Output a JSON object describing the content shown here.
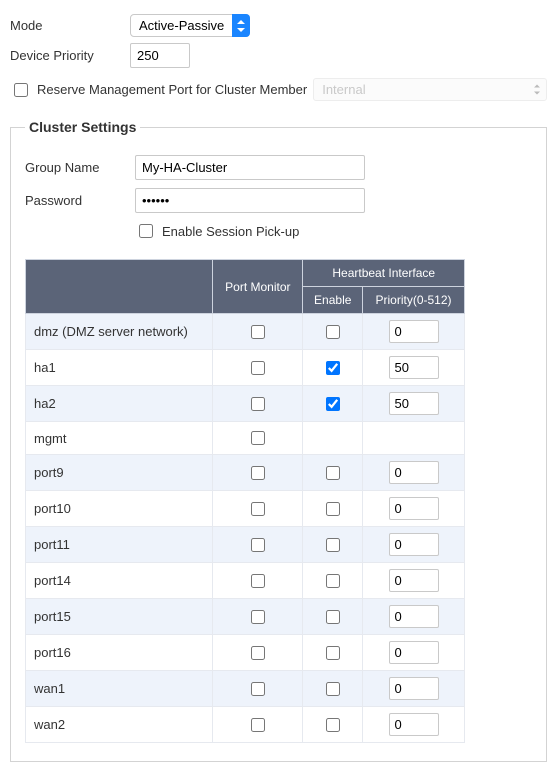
{
  "top": {
    "mode_label": "Mode",
    "mode_value": "Active-Passive",
    "device_priority_label": "Device Priority",
    "device_priority_value": "250",
    "reserve_checked": false,
    "reserve_label": "Reserve Management Port for Cluster Member",
    "reserve_port_value": "Internal"
  },
  "cluster": {
    "legend": "Cluster Settings",
    "group_name_label": "Group Name",
    "group_name_value": "My-HA-Cluster",
    "password_label": "Password",
    "password_value": "••••••",
    "session_pickup_checked": false,
    "session_pickup_label": "Enable Session Pick-up",
    "headers": {
      "port_monitor": "Port Monitor",
      "heartbeat": "Heartbeat Interface",
      "enable": "Enable",
      "priority": "Priority(0-512)"
    },
    "rows": [
      {
        "name": "dmz (DMZ server network)",
        "port_monitor": false,
        "hb_enable": false,
        "hb_priority": "0",
        "has_priority": true
      },
      {
        "name": "ha1",
        "port_monitor": false,
        "hb_enable": true,
        "hb_priority": "50",
        "has_priority": true
      },
      {
        "name": "ha2",
        "port_monitor": false,
        "hb_enable": true,
        "hb_priority": "50",
        "has_priority": true
      },
      {
        "name": "mgmt",
        "port_monitor": false,
        "hb_enable": null,
        "hb_priority": null,
        "has_priority": false
      },
      {
        "name": "port9",
        "port_monitor": false,
        "hb_enable": false,
        "hb_priority": "0",
        "has_priority": true
      },
      {
        "name": "port10",
        "port_monitor": false,
        "hb_enable": false,
        "hb_priority": "0",
        "has_priority": true
      },
      {
        "name": "port11",
        "port_monitor": false,
        "hb_enable": false,
        "hb_priority": "0",
        "has_priority": true
      },
      {
        "name": "port14",
        "port_monitor": false,
        "hb_enable": false,
        "hb_priority": "0",
        "has_priority": true
      },
      {
        "name": "port15",
        "port_monitor": false,
        "hb_enable": false,
        "hb_priority": "0",
        "has_priority": true
      },
      {
        "name": "port16",
        "port_monitor": false,
        "hb_enable": false,
        "hb_priority": "0",
        "has_priority": true
      },
      {
        "name": "wan1",
        "port_monitor": false,
        "hb_enable": false,
        "hb_priority": "0",
        "has_priority": true
      },
      {
        "name": "wan2",
        "port_monitor": false,
        "hb_enable": false,
        "hb_priority": "0",
        "has_priority": true
      }
    ]
  }
}
